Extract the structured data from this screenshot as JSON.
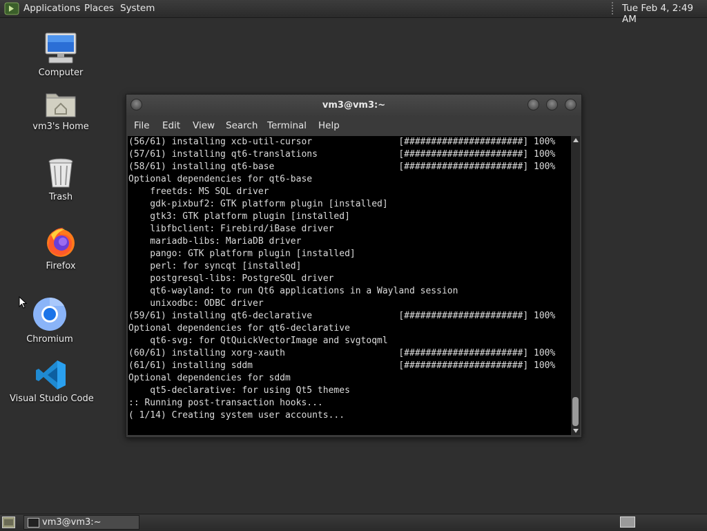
{
  "top_panel": {
    "menus": [
      "Applications",
      "Places",
      "System"
    ],
    "clock": "Tue Feb  4,  2:49 AM"
  },
  "desktop": {
    "icons": [
      {
        "label": "Computer",
        "icon": "computer-icon"
      },
      {
        "label": "vm3's Home",
        "icon": "home-folder-icon"
      },
      {
        "label": "Trash",
        "icon": "trash-icon"
      },
      {
        "label": "Firefox",
        "icon": "firefox-icon"
      },
      {
        "label": "Chromium",
        "icon": "chromium-icon"
      },
      {
        "label": "Visual Studio Code",
        "icon": "vscode-icon"
      }
    ]
  },
  "terminal": {
    "title": "vm3@vm3:~",
    "menu": [
      "File",
      "Edit",
      "View",
      "Search",
      "Terminal",
      "Help"
    ],
    "lines": [
      "(56/61) installing xcb-util-cursor                [######################] 100%",
      "(57/61) installing qt6-translations               [######################] 100%",
      "(58/61) installing qt6-base                       [######################] 100%",
      "Optional dependencies for qt6-base",
      "    freetds: MS SQL driver",
      "    gdk-pixbuf2: GTK platform plugin [installed]",
      "    gtk3: GTK platform plugin [installed]",
      "    libfbclient: Firebird/iBase driver",
      "    mariadb-libs: MariaDB driver",
      "    pango: GTK platform plugin [installed]",
      "    perl: for syncqt [installed]",
      "    postgresql-libs: PostgreSQL driver",
      "    qt6-wayland: to run Qt6 applications in a Wayland session",
      "    unixodbc: ODBC driver",
      "(59/61) installing qt6-declarative                [######################] 100%",
      "Optional dependencies for qt6-declarative",
      "    qt6-svg: for QtQuickVectorImage and svgtoqml",
      "(60/61) installing xorg-xauth                     [######################] 100%",
      "(61/61) installing sddm                           [######################] 100%",
      "Optional dependencies for sddm",
      "    qt5-declarative: for using Qt5 themes",
      ":: Running post-transaction hooks...",
      "( 1/14) Creating system user accounts..."
    ]
  },
  "taskbar": {
    "window_label": "vm3@vm3:~"
  }
}
